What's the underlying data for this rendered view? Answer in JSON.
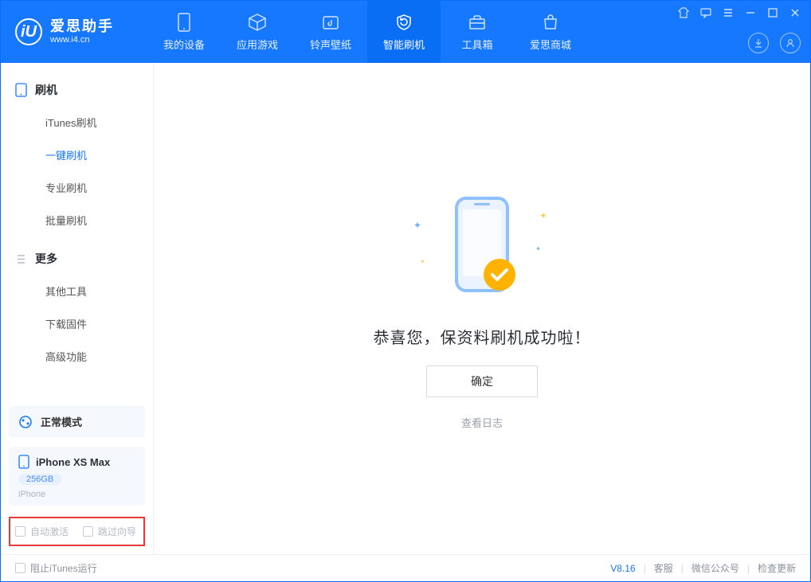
{
  "logo": {
    "title": "爱思助手",
    "url": "www.i4.cn",
    "glyph": "iU"
  },
  "nav": {
    "items": [
      {
        "label": "我的设备"
      },
      {
        "label": "应用游戏"
      },
      {
        "label": "铃声壁纸"
      },
      {
        "label": "智能刷机"
      },
      {
        "label": "工具箱"
      },
      {
        "label": "爱思商城"
      }
    ]
  },
  "sidebar": {
    "group_flash": "刷机",
    "group_more": "更多",
    "items_flash": [
      {
        "label": "iTunes刷机"
      },
      {
        "label": "一键刷机"
      },
      {
        "label": "专业刷机"
      },
      {
        "label": "批量刷机"
      }
    ],
    "items_more": [
      {
        "label": "其他工具"
      },
      {
        "label": "下载固件"
      },
      {
        "label": "高级功能"
      }
    ],
    "mode_label": "正常模式",
    "device_name": "iPhone XS Max",
    "device_storage": "256GB",
    "device_type": "iPhone",
    "opt_auto_activate": "自动激活",
    "opt_skip_guide": "跳过向导"
  },
  "content": {
    "success_text": "恭喜您，保资料刷机成功啦！",
    "ok_label": "确定",
    "log_link": "查看日志"
  },
  "statusbar": {
    "block_itunes": "阻止iTunes运行",
    "version": "V8.16",
    "links": {
      "support": "客服",
      "wechat": "微信公众号",
      "update": "检查更新"
    }
  }
}
